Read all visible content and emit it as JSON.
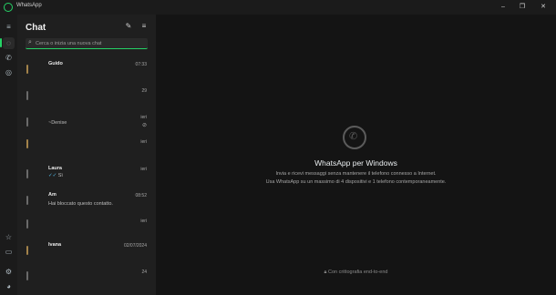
{
  "window": {
    "title": "WhatsApp"
  },
  "rail": {
    "items": [
      {
        "icon": "menu-icon",
        "glyph": "≡"
      },
      {
        "icon": "chats-icon",
        "glyph": "◌"
      },
      {
        "icon": "calls-icon",
        "glyph": "✆"
      },
      {
        "icon": "status-icon",
        "glyph": "◎"
      },
      {
        "icon": "starred-icon",
        "glyph": "☆"
      },
      {
        "icon": "archive-icon",
        "glyph": "▭"
      },
      {
        "icon": "settings-icon",
        "glyph": "⚙"
      },
      {
        "icon": "profile-icon",
        "glyph": "◕"
      }
    ]
  },
  "chatlist": {
    "title": "Chat",
    "search_placeholder": "Cerca o inizia una nuova chat",
    "chats": [
      {
        "name": "Guido",
        "time": "07:33",
        "preview": "",
        "icon": ""
      },
      {
        "name": "",
        "time": "",
        "preview": "",
        "icon": "29"
      },
      {
        "name": "",
        "time": "ieri",
        "preview": "~Denise",
        "icon": "⊘"
      },
      {
        "name": "",
        "time": "ieri",
        "preview": "",
        "icon": ""
      },
      {
        "name": "Laura",
        "time": "ieri",
        "preview": "Sì",
        "icon": ""
      },
      {
        "name": "Am",
        "time": "08:52",
        "preview": "Hai bloccato questo contatto.",
        "icon": ""
      },
      {
        "name": "",
        "time": "ieri",
        "preview": "",
        "icon": ""
      },
      {
        "name": "Ivana",
        "time": "02/07/2024",
        "preview": "",
        "icon": ""
      },
      {
        "name": "",
        "time": "24",
        "preview": "",
        "icon": ""
      }
    ]
  },
  "main": {
    "title": "WhatsApp per Windows",
    "line1": "Invia e ricevi messaggi senza mantenere il telefono connesso a Internet.",
    "line2": "Usa WhatsApp su un massimo di 4 dispositivi e 1 telefono contemporaneamente.",
    "e2e": "Con crittografia end-to-end"
  },
  "colors": {
    "accent": "#25d366",
    "background": "#111111",
    "panel": "#1f1f1f"
  }
}
